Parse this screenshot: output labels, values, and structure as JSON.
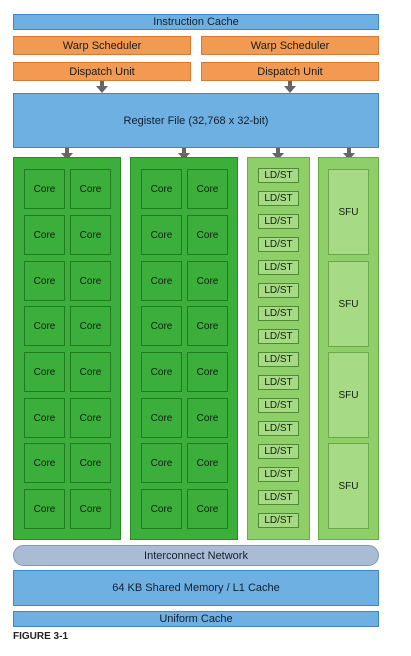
{
  "instruction_cache": "Instruction Cache",
  "warp_scheduler": "Warp Scheduler",
  "dispatch_unit": "Dispatch Unit",
  "register_file": "Register File (32,768 x 32-bit)",
  "core": "Core",
  "ldst": "LD/ST",
  "sfu": "SFU",
  "interconnect": "Interconnect Network",
  "shared_memory": "64 KB Shared Memory / L1 Cache",
  "uniform_cache": "Uniform Cache",
  "figure_caption": "FIGURE 3-1",
  "colors": {
    "cache_blue": "#6fb0e2",
    "scheduler_orange": "#f29a52",
    "core_green": "#3cae3c",
    "ldst_green": "#a6da84",
    "interconnect_grey": "#a9bcd4"
  }
}
